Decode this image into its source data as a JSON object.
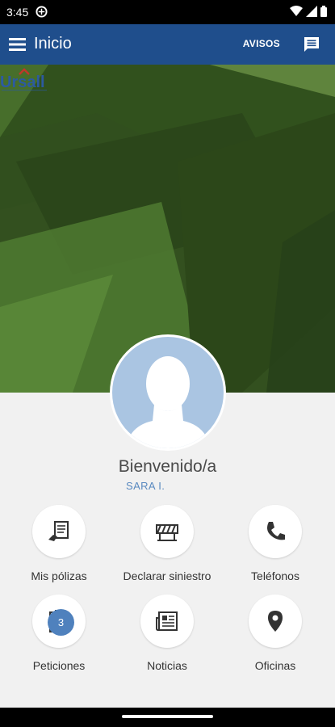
{
  "status_bar": {
    "time": "3:45"
  },
  "app_bar": {
    "title": "Inicio",
    "avisos_label": "AVISOS"
  },
  "brand": {
    "logo_text": "Ursall",
    "accent": "#1f4e8c",
    "hero_green": "#3f6325",
    "link_blue": "#5a8ac0",
    "badge_blue": "#4f81bd"
  },
  "welcome": {
    "greeting": "Bienvenido/a",
    "user_name": "SARA I."
  },
  "actions": [
    {
      "label": "Mis pólizas",
      "icon": "policy-document-icon"
    },
    {
      "label": "Declarar siniestro",
      "icon": "roadblock-icon"
    },
    {
      "label": "Teléfonos",
      "icon": "phone-icon"
    },
    {
      "label": "Peticiones",
      "icon": "clipboard-check-icon",
      "badge": "3"
    },
    {
      "label": "Noticias",
      "icon": "newspaper-icon"
    },
    {
      "label": "Oficinas",
      "icon": "location-pin-icon"
    }
  ]
}
